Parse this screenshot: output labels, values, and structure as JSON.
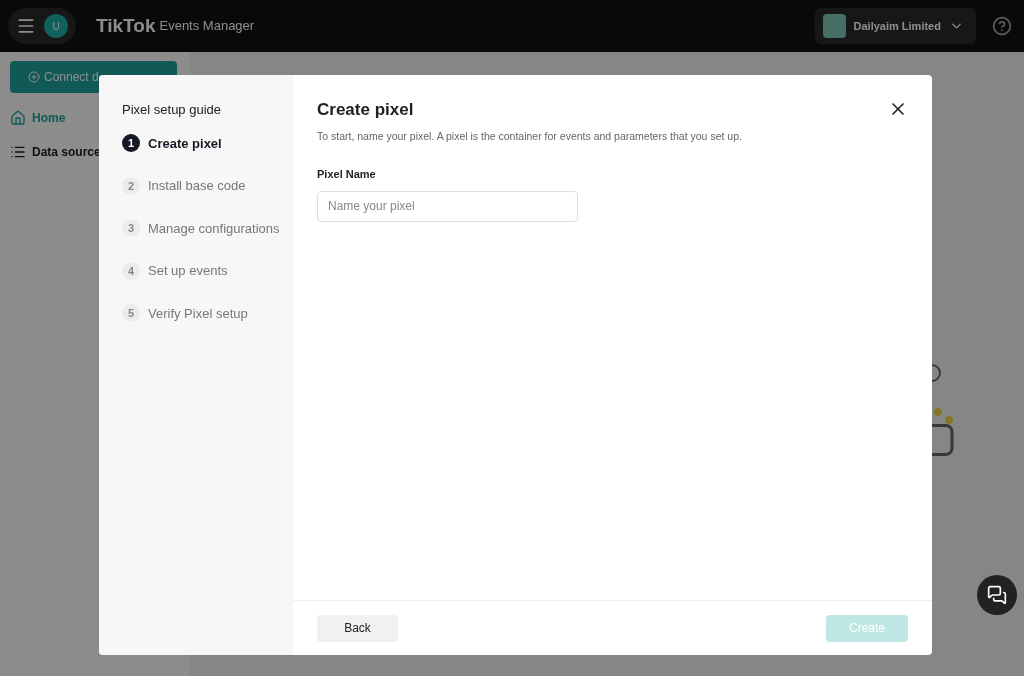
{
  "header": {
    "avatar": "U",
    "logo": "TikTok",
    "product": "Events Manager",
    "account": "Dailyaim Limited"
  },
  "sidebar": {
    "connect_button": "Connect d",
    "items": [
      {
        "label": "Home",
        "selected": true,
        "kind": "home"
      },
      {
        "label": "Data source",
        "selected": false,
        "kind": "list"
      }
    ]
  },
  "modal": {
    "guide_title": "Pixel setup guide",
    "steps": [
      {
        "number": "1",
        "label": "Create pixel",
        "selected": true
      },
      {
        "number": "2",
        "label": "Install base code",
        "selected": false
      },
      {
        "number": "3",
        "label": "Manage configurations",
        "selected": false
      },
      {
        "number": "4",
        "label": "Set up events",
        "selected": false
      },
      {
        "number": "5",
        "label": "Verify Pixel setup",
        "selected": false
      }
    ],
    "title": "Create pixel",
    "description": "To start, name your pixel. A pixel is the container for events and parameters that you set up.",
    "field_label": "Pixel Name",
    "field_placeholder": "Name your pixel",
    "back_button": "Back",
    "create_button": {
      "label": "Create",
      "disabled": true
    }
  }
}
